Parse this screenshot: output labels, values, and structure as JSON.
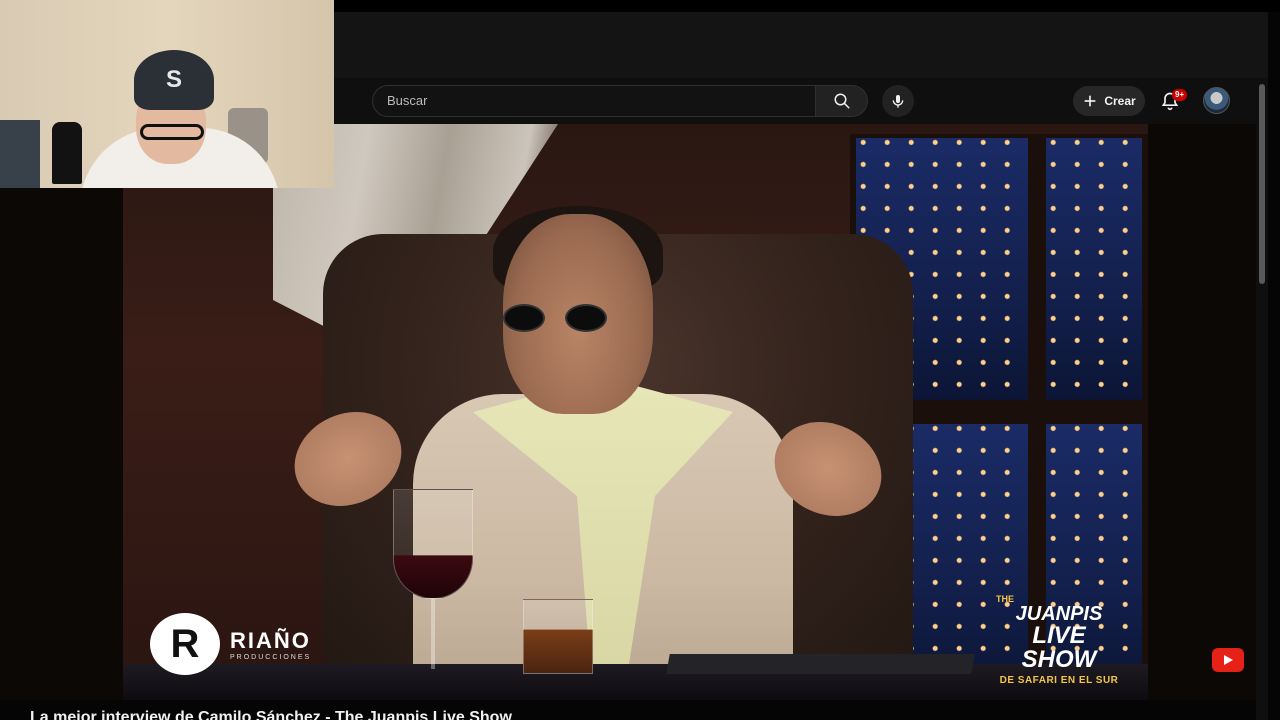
{
  "header": {
    "search_placeholder": "Buscar",
    "create_label": "Crear",
    "notification_count": "9+"
  },
  "video": {
    "logo_left": {
      "mark": "R",
      "name": "RIAÑO",
      "sub": "PRODUCCIONES"
    },
    "logo_right": {
      "the": "THE",
      "name": "JUANPIS",
      "live_show": "LIVE SHOW",
      "subtitle": "DE SAFARI EN EL SUR"
    },
    "title": "La mejor interview de Camilo Sánchez - The Juanpis Live Show"
  },
  "webcam": {
    "cap_logo": "S"
  },
  "colors": {
    "header_bg": "#0f0f0f",
    "accent_red": "#cc0000",
    "youtube_red": "#e62117",
    "show_gold": "#f3c54a"
  }
}
